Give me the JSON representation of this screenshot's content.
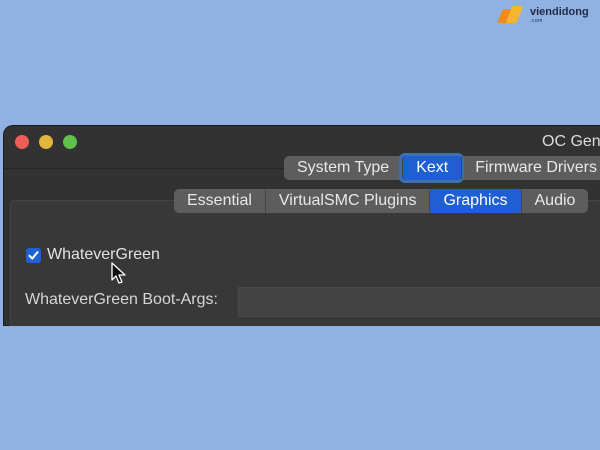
{
  "watermark": {
    "name": "viendidong",
    "sub": ".com"
  },
  "window": {
    "title": "OC Gen"
  },
  "top_tabs": [
    {
      "label": "System Type",
      "active": false
    },
    {
      "label": "Kext",
      "active": true
    },
    {
      "label": "Firmware Drivers",
      "active": false
    }
  ],
  "kext_tabs": [
    {
      "label": "Essential",
      "active": false
    },
    {
      "label": "VirtualSMC Plugins",
      "active": false
    },
    {
      "label": "Graphics",
      "active": true
    },
    {
      "label": "Audio",
      "active": false
    }
  ],
  "graphics": {
    "whatevergreen_checkbox": {
      "label": "WhateverGreen",
      "checked": true
    },
    "bootargs": {
      "label": "WhateverGreen Boot-Args:",
      "value": ""
    }
  },
  "colors": {
    "accent": "#1e5fd4",
    "desktop": "#8fb2e3",
    "window_bg": "#323232"
  }
}
